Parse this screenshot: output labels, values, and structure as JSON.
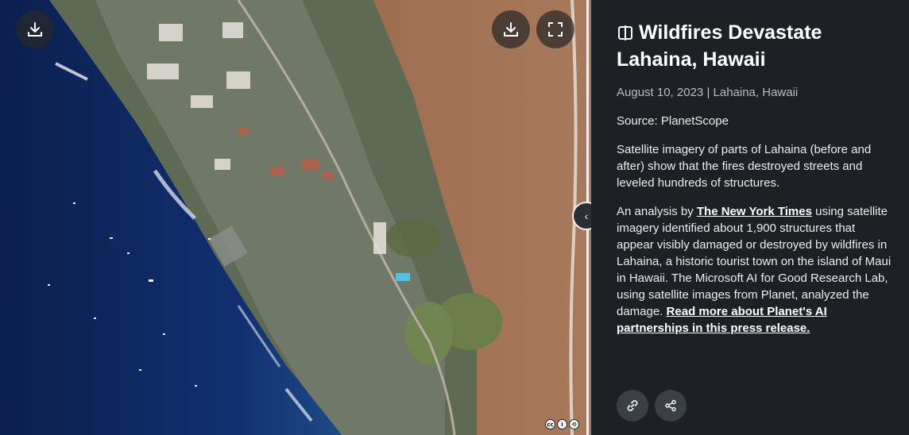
{
  "story": {
    "title": "Wildfires Devastate Lahaina, Hawaii",
    "title_icon": "compare-icon",
    "date": "August 10, 2023",
    "separator": "|",
    "location": "Lahaina, Hawaii",
    "source": "Source: PlanetScope",
    "paragraph1": "Satellite imagery of parts of Lahaina (before and after) show that the fires destroyed streets and leveled hundreds of structures.",
    "paragraph2": {
      "text_before": "An analysis by ",
      "link1": "The New York Times",
      "text_middle": " using satellite imagery identified about 1,900 structures that appear visibly damaged or destroyed by wildfires in Lahaina, a historic tourist town on the island of Maui in Hawaii. The Microsoft AI for Good Research Lab, using satellite images from Planet, analyzed the damage. ",
      "link2": "Read more about Planet's AI partnerships in this press release."
    }
  },
  "map_controls": {
    "download_icon": "download-icon",
    "fullscreen_icon": "fullscreen-icon",
    "slider_handle_icon": "chevron-left-icon",
    "license_icons": [
      "cc-icon",
      "by-icon",
      "sa-icon"
    ]
  },
  "share_actions": {
    "link_icon": "link-icon",
    "share_icon": "share-icon"
  },
  "colors": {
    "panel_bg": "#1d2125",
    "ocean": "#0d2a5c",
    "land_dry": "#9a6a46"
  }
}
